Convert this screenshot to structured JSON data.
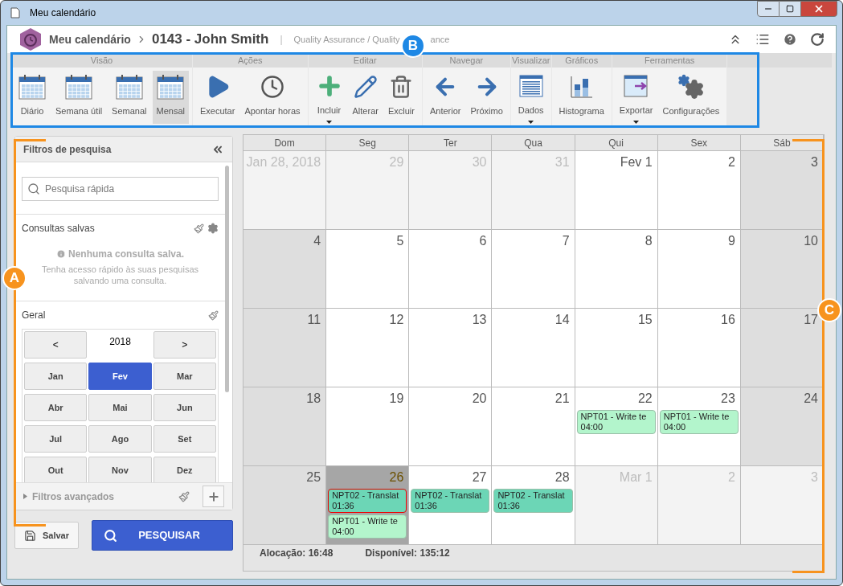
{
  "window": {
    "title": "Meu calendário"
  },
  "header": {
    "breadcrumb": "Meu calendário",
    "title": "0143 - John Smith",
    "separator": "|",
    "subtitle": "Quality Assurance / Quality",
    "subtitle_tail": "ance"
  },
  "ribbon": [
    {
      "label": "Visão",
      "items": [
        {
          "label": "Diário",
          "selected": false,
          "dropdown": false
        },
        {
          "label": "Semana útil",
          "selected": false,
          "dropdown": false
        },
        {
          "label": "Semanal",
          "selected": false,
          "dropdown": false
        },
        {
          "label": "Mensal",
          "selected": true,
          "dropdown": false
        }
      ]
    },
    {
      "label": "Ações",
      "items": [
        {
          "label": "Executar",
          "selected": false,
          "dropdown": false
        },
        {
          "label": "Apontar horas",
          "selected": false,
          "dropdown": false
        }
      ]
    },
    {
      "label": "Editar",
      "items": [
        {
          "label": "Incluir",
          "selected": false,
          "dropdown": true
        },
        {
          "label": "Alterar",
          "selected": false,
          "dropdown": false
        },
        {
          "label": "Excluir",
          "selected": false,
          "dropdown": false
        }
      ]
    },
    {
      "label": "Navegar",
      "items": [
        {
          "label": "Anterior",
          "selected": false,
          "dropdown": false
        },
        {
          "label": "Próximo",
          "selected": false,
          "dropdown": false
        }
      ]
    },
    {
      "label": "Visualizar",
      "items": [
        {
          "label": "Dados",
          "selected": false,
          "dropdown": true
        }
      ]
    },
    {
      "label": "Gráficos",
      "items": [
        {
          "label": "Histograma",
          "selected": false,
          "dropdown": false
        }
      ]
    },
    {
      "label": "Ferramentas",
      "items": [
        {
          "label": "Exportar",
          "selected": false,
          "dropdown": true
        },
        {
          "label": "Configurações",
          "selected": false,
          "dropdown": false
        }
      ]
    }
  ],
  "filters": {
    "title": "Filtros de pesquisa",
    "search": {
      "placeholder": "Pesquisa rápida"
    },
    "saved": {
      "title": "Consultas salvas",
      "empty_title": "Nenhuma consulta salva.",
      "empty_text": "Tenha acesso rápido às suas pesquisas salvando uma consulta."
    },
    "general": {
      "title": "Geral",
      "prev": "<",
      "year": "2018",
      "next": ">",
      "months": [
        {
          "label": "Jan",
          "selected": false
        },
        {
          "label": "Fev",
          "selected": true
        },
        {
          "label": "Mar",
          "selected": false
        },
        {
          "label": "Abr",
          "selected": false
        },
        {
          "label": "Mai",
          "selected": false
        },
        {
          "label": "Jun",
          "selected": false
        },
        {
          "label": "Jul",
          "selected": false
        },
        {
          "label": "Ago",
          "selected": false
        },
        {
          "label": "Set",
          "selected": false
        },
        {
          "label": "Out",
          "selected": false
        },
        {
          "label": "Nov",
          "selected": false
        },
        {
          "label": "Dez",
          "selected": false
        }
      ]
    },
    "advanced": {
      "label": "Filtros avançados",
      "expanded": false
    }
  },
  "save_button": "Salvar",
  "search_button": "PESQUISAR",
  "calendar": {
    "weekdays": [
      "Dom",
      "Seg",
      "Ter",
      "Qua",
      "Qui",
      "Sex",
      "Sáb"
    ],
    "days": [
      {
        "day": "Jan 28, 2018",
        "kind": "other"
      },
      {
        "day": "29",
        "kind": "other"
      },
      {
        "day": "30",
        "kind": "other"
      },
      {
        "day": "31",
        "kind": "other"
      },
      {
        "day": "Fev 1",
        "kind": "weekday"
      },
      {
        "day": "2",
        "kind": "weekday"
      },
      {
        "day": "3",
        "kind": "weekend"
      },
      {
        "day": "4",
        "kind": "weekend"
      },
      {
        "day": "5",
        "kind": "weekday"
      },
      {
        "day": "6",
        "kind": "weekday"
      },
      {
        "day": "7",
        "kind": "weekday"
      },
      {
        "day": "8",
        "kind": "weekday"
      },
      {
        "day": "9",
        "kind": "weekday"
      },
      {
        "day": "10",
        "kind": "weekend"
      },
      {
        "day": "11",
        "kind": "weekend"
      },
      {
        "day": "12",
        "kind": "weekday"
      },
      {
        "day": "13",
        "kind": "weekday"
      },
      {
        "day": "14",
        "kind": "weekday"
      },
      {
        "day": "15",
        "kind": "weekday"
      },
      {
        "day": "16",
        "kind": "weekday"
      },
      {
        "day": "17",
        "kind": "weekend"
      },
      {
        "day": "18",
        "kind": "weekend"
      },
      {
        "day": "19",
        "kind": "weekday"
      },
      {
        "day": "20",
        "kind": "weekday"
      },
      {
        "day": "21",
        "kind": "weekday"
      },
      {
        "day": "22",
        "kind": "weekday",
        "events": [
          {
            "text": "NPT01 - Write te",
            "time": "04:00",
            "color": "#b3f5cc",
            "selected": false
          }
        ]
      },
      {
        "day": "23",
        "kind": "weekday",
        "events": [
          {
            "text": "NPT01 - Write te",
            "time": "04:00",
            "color": "#b3f5cc",
            "selected": false
          }
        ]
      },
      {
        "day": "24",
        "kind": "weekend"
      },
      {
        "day": "25",
        "kind": "weekend"
      },
      {
        "day": "26",
        "kind": "today",
        "events": [
          {
            "text": "NPT02 - Translat",
            "time": "01:36",
            "color": "#6cd6b6",
            "selected": true
          },
          {
            "text": "NPT01 - Write te",
            "time": "04:00",
            "color": "#b3f5cc",
            "selected": false
          }
        ]
      },
      {
        "day": "27",
        "kind": "weekday",
        "events": [
          {
            "text": "NPT02 - Translat",
            "time": "01:36",
            "color": "#6cd6b6",
            "selected": false
          }
        ]
      },
      {
        "day": "28",
        "kind": "weekday",
        "events": [
          {
            "text": "NPT02 - Translat",
            "time": "01:36",
            "color": "#6cd6b6",
            "selected": false
          }
        ]
      },
      {
        "day": "Mar 1",
        "kind": "other"
      },
      {
        "day": "2",
        "kind": "other"
      },
      {
        "day": "3",
        "kind": "other"
      }
    ],
    "footer": [
      "Alocação: 16:48",
      "Disponível: 135:12"
    ]
  },
  "callouts": [
    {
      "label": "A",
      "color": "#f7931e"
    },
    {
      "label": "B",
      "color": "#1e88e5"
    },
    {
      "label": "C",
      "color": "#f7931e"
    }
  ]
}
